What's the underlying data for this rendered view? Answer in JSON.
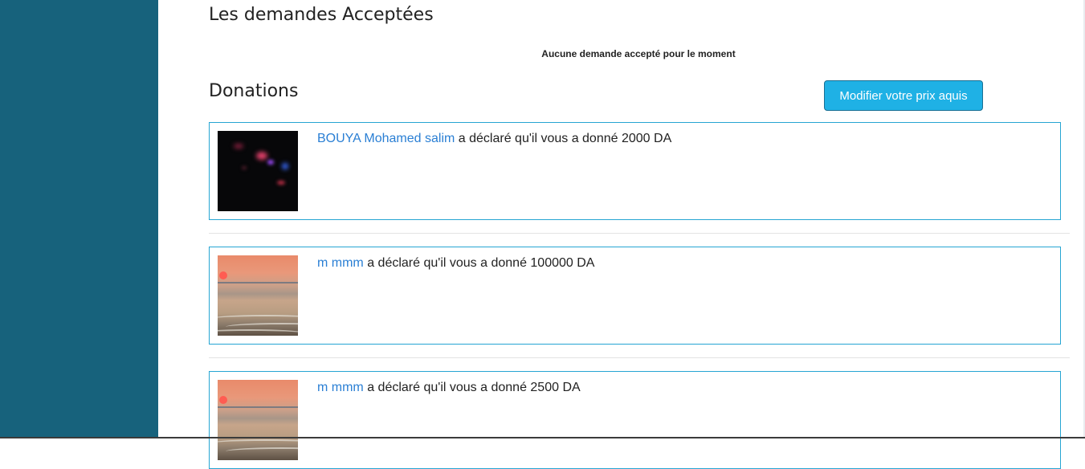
{
  "accepted": {
    "title": "Les demandes Acceptées",
    "empty_message": "Aucune demande accepté pour le moment"
  },
  "donations": {
    "title": "Donations",
    "modify_button": "Modifier votre prix aquis",
    "items": [
      {
        "donor": "BOUYA Mohamed salim",
        "text": " a déclaré qu'il vous a donné 2000 DA",
        "image": "night-scene-photo"
      },
      {
        "donor": "m mmm",
        "text": " a déclaré qu'il vous a donné 100000 DA",
        "image": "sunset-beach-photo"
      },
      {
        "donor": "m mmm",
        "text": " a déclaré qu'il vous a donné 2500 DA",
        "image": "sunset-beach-photo"
      }
    ]
  },
  "colors": {
    "sidebar": "#17627c",
    "accent": "#1fb1e5",
    "card_border": "#26a5d3",
    "link": "#2a7fd4"
  }
}
